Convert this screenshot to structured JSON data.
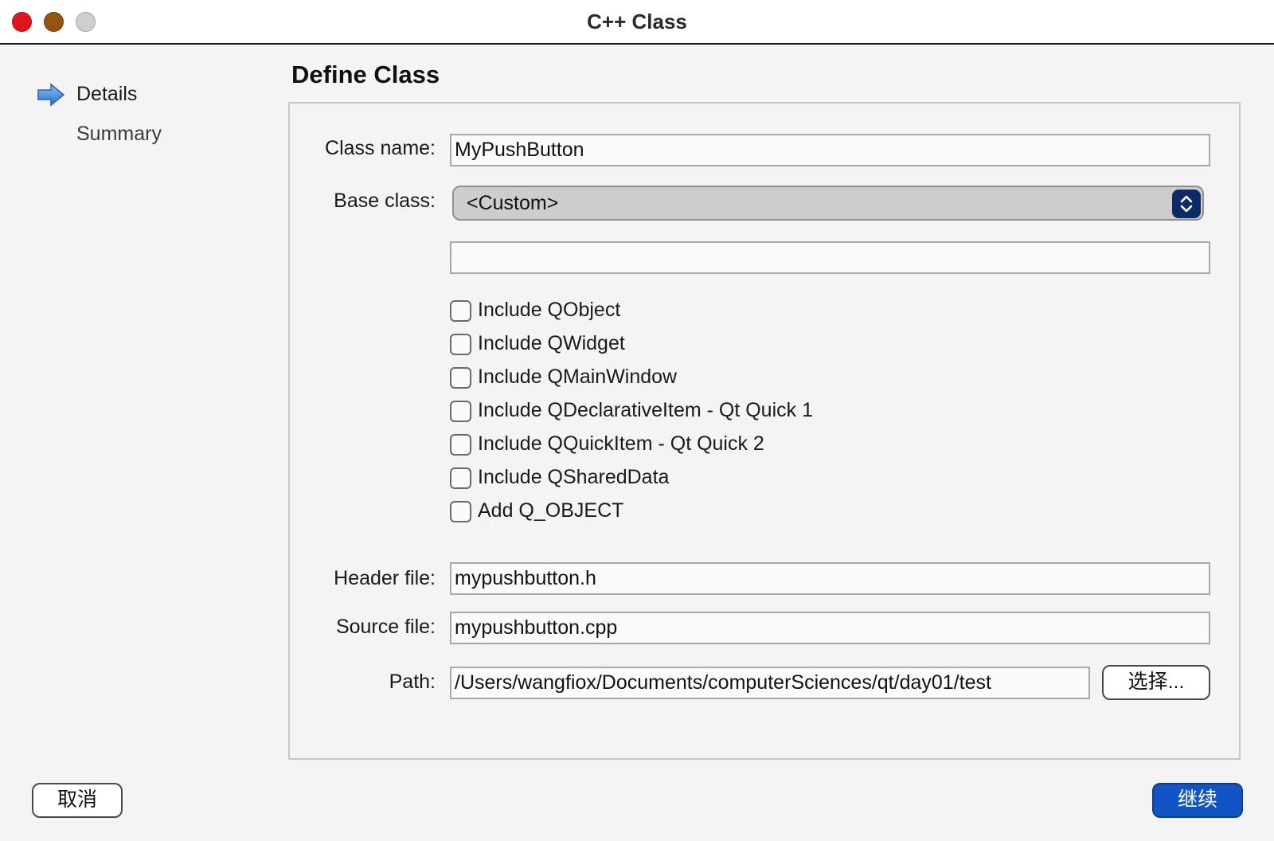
{
  "window": {
    "title": "C++ Class"
  },
  "sidebar": {
    "items": [
      {
        "label": "Details",
        "current": true
      },
      {
        "label": "Summary",
        "current": false
      }
    ]
  },
  "page": {
    "title": "Define Class"
  },
  "form": {
    "class_name": {
      "label": "Class name:",
      "value": "MyPushButton"
    },
    "base_class": {
      "label": "Base class:",
      "selected": "<Custom>",
      "custom_value": ""
    },
    "checkboxes": [
      {
        "label": "Include QObject",
        "checked": false
      },
      {
        "label": "Include QWidget",
        "checked": false
      },
      {
        "label": "Include QMainWindow",
        "checked": false
      },
      {
        "label": "Include QDeclarativeItem - Qt Quick 1",
        "checked": false
      },
      {
        "label": "Include QQuickItem - Qt Quick 2",
        "checked": false
      },
      {
        "label": "Include QSharedData",
        "checked": false
      },
      {
        "label": "Add Q_OBJECT",
        "checked": false
      }
    ],
    "header_file": {
      "label": "Header file:",
      "value": "mypushbutton.h"
    },
    "source_file": {
      "label": "Source file:",
      "value": "mypushbutton.cpp"
    },
    "path": {
      "label": "Path:",
      "value": "/Users/wangfiox/Documents/computerSciences/qt/day01/test",
      "browse_label": "选择..."
    }
  },
  "footer": {
    "cancel_label": "取消",
    "continue_label": "继续"
  },
  "colors": {
    "primary_button": "#1155c4",
    "close": "#e0151b",
    "minimize": "#935610",
    "zoom": "#cfcfcf",
    "arrow": "#3f86e0"
  }
}
